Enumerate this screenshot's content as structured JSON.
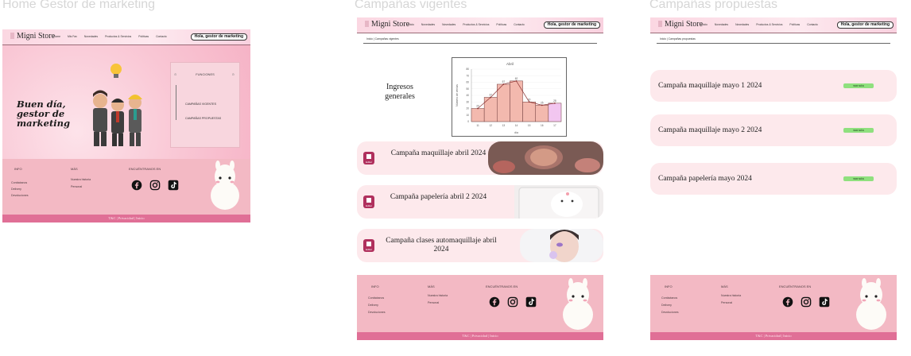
{
  "screens": [
    {
      "title": "Home Gestor de marketing"
    },
    {
      "title": "Campañas vigentes"
    },
    {
      "title": "Campañas propuestas"
    }
  ],
  "brand": "Migni Store",
  "nav": {
    "home_frame": [
      "Home",
      "Mis Fav",
      "Novedades",
      "Productos & Servicios",
      "Políticas",
      "Contacto"
    ],
    "other_frames": [
      "Inicio",
      "Novedades",
      "Novedades",
      "Productos & Servicios",
      "Políticas",
      "Contacto"
    ]
  },
  "greeting_button": "Hola, gestor de marketing",
  "home": {
    "hero_greeting": "Buen día, gestor de marketing",
    "panel": {
      "heading": "FUNCIONES",
      "buttons": [
        "CAMPAÑAS VIGENTES",
        "CAMPAÑAS PROPUESTAS"
      ]
    }
  },
  "vigentes": {
    "breadcrumb": "Inicio    |    Campañas vigentes",
    "ingresos_label": "Ingresos generales",
    "campaigns": [
      {
        "title": "Campaña maquillaje abril 2024",
        "icon_label": "Editar",
        "image": "makeup-palette-photo"
      },
      {
        "title": "Campaña papelería abril 2 2024",
        "icon_label": "Editar",
        "image": "notebook-illustration"
      },
      {
        "title": "Campaña clases automaquillaje abril 2024",
        "icon_label": "Editar",
        "image": "makeup-model-photo"
      }
    ]
  },
  "propuestas": {
    "breadcrumb": "Inicio    |    Campañas propuestas",
    "proposals": [
      {
        "title": "Campaña maquillaje mayo 1 2024",
        "action": "VER MÁS"
      },
      {
        "title": "Campaña maquillaje mayo 2 2024",
        "action": "VER MÁS"
      },
      {
        "title": "Campaña papelería mayo 2024",
        "action": "VER MÁS"
      }
    ]
  },
  "footer": {
    "info_heading": "INFO",
    "info_items": [
      "Contáctanos",
      "Delivery",
      "Devoluciones"
    ],
    "more_heading": "MÁS",
    "more_items": [
      "Nuestra historia",
      "Personal"
    ],
    "social_heading": "ENCUÉNTRANOS EN",
    "social_icons": [
      "facebook-icon",
      "instagram-icon",
      "tiktok-icon"
    ],
    "bottom_text": "T&C | Privacidad | Inicio"
  },
  "chart_data": {
    "type": "bar",
    "title": "Abril",
    "xlabel": "día",
    "ylabel": "Número de ventas",
    "categories": [
      "11",
      "12",
      "13",
      "14",
      "15",
      "16",
      "17"
    ],
    "values": [
      20,
      37,
      57,
      62,
      30,
      25,
      28
    ],
    "line_overlay": true,
    "ylim": [
      0,
      80
    ],
    "yticks": [
      0,
      10,
      20,
      30,
      40,
      50,
      60,
      70,
      80
    ],
    "bar_color": "#f3b9ae",
    "last_bar_color": "#f2c6f0",
    "line_color": "#8a2f2f"
  },
  "colors": {
    "header_pink": "#fbd7e2",
    "footer_pink": "#f3b9c4",
    "footer_bar": "#e06f96",
    "card_pink": "#fde9ec",
    "edit_icon": "#b0305d",
    "ver_mas": "#8fe07e"
  }
}
